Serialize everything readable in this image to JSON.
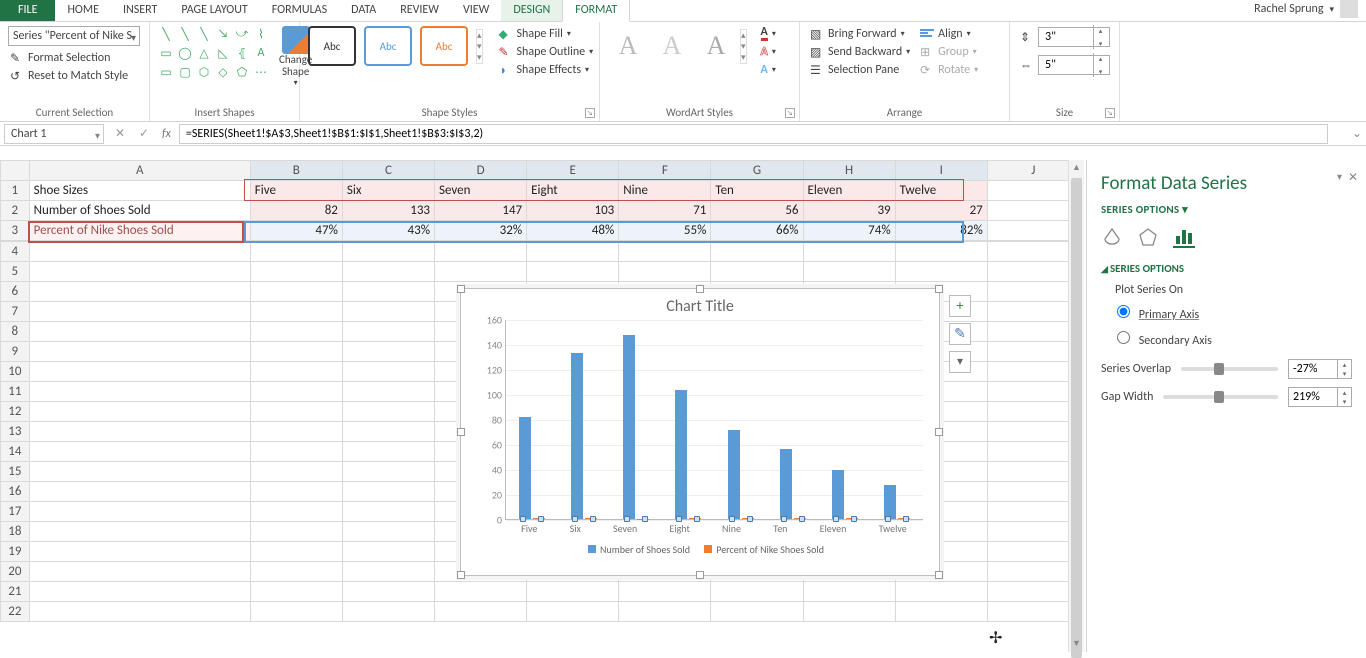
{
  "app": {
    "user_name": "Rachel Sprung"
  },
  "tabs": [
    "FILE",
    "HOME",
    "INSERT",
    "PAGE LAYOUT",
    "FORMULAS",
    "DATA",
    "REVIEW",
    "VIEW",
    "DESIGN",
    "FORMAT"
  ],
  "ribbon": {
    "selection_value": "Series \"Percent of Nike S",
    "format_selection": "Format Selection",
    "reset_match": "Reset to Match Style",
    "change_shape": "Change Shape",
    "abc": "Abc",
    "shape_fill": "Shape Fill",
    "shape_outline": "Shape Outline",
    "shape_effects": "Shape Effects",
    "bring_forward": "Bring Forward",
    "send_backward": "Send Backward",
    "selection_pane": "Selection Pane",
    "align": "Align",
    "group": "Group",
    "rotate": "Rotate",
    "height_val": "3\"",
    "width_val": "5\"",
    "groups": {
      "current_selection": "Current Selection",
      "insert_shapes": "Insert Shapes",
      "shape_styles": "Shape Styles",
      "wordart_styles": "WordArt Styles",
      "arrange": "Arrange",
      "size": "Size"
    }
  },
  "formula_bar": {
    "name_box": "Chart 1",
    "formula": "=SERIES(Sheet1!$A$3,Sheet1!$B$1:$I$1,Sheet1!$B$3:$I$3,2)"
  },
  "columns": [
    "",
    "A",
    "B",
    "C",
    "D",
    "E",
    "F",
    "G",
    "H",
    "I",
    "J"
  ],
  "sheet": {
    "r1": [
      "Shoe Sizes",
      "Five",
      "Six",
      "Seven",
      "Eight",
      "Nine",
      "Ten",
      "Eleven",
      "Twelve",
      ""
    ],
    "r2": [
      "Number of Shoes Sold",
      "82",
      "133",
      "147",
      "103",
      "71",
      "56",
      "39",
      "27",
      ""
    ],
    "r3": [
      "Percent of Nike Shoes Sold",
      "47%",
      "43%",
      "32%",
      "48%",
      "55%",
      "66%",
      "74%",
      "82%",
      ""
    ]
  },
  "pane": {
    "title": "Format Data Series",
    "subtitle": "SERIES OPTIONS",
    "section": "SERIES OPTIONS",
    "plot_on": "Plot Series On",
    "primary": "Primary Axis",
    "secondary": "Secondary Axis",
    "overlap_label": "Series Overlap",
    "overlap_value": "-27%",
    "gap_label": "Gap Width",
    "gap_value": "219%"
  },
  "chart_side_btns": [
    "+",
    "✎",
    "▼"
  ],
  "chart_data": {
    "type": "bar",
    "title": "Chart Title",
    "categories": [
      "Five",
      "Six",
      "Seven",
      "Eight",
      "Nine",
      "Ten",
      "Eleven",
      "Twelve"
    ],
    "series": [
      {
        "name": "Number of Shoes Sold",
        "values": [
          82,
          133,
          147,
          103,
          71,
          56,
          39,
          27
        ],
        "color": "#5b9bd5"
      },
      {
        "name": "Percent of Nike Shoes Sold",
        "values": [
          0.47,
          0.43,
          0.32,
          0.48,
          0.55,
          0.66,
          0.74,
          0.82
        ],
        "color": "#ed7d31"
      }
    ],
    "ylim": [
      0,
      160
    ],
    "yticks": [
      0,
      20,
      40,
      60,
      80,
      100,
      120,
      140,
      160
    ],
    "selected_series_index": 1,
    "legend_position": "bottom"
  }
}
